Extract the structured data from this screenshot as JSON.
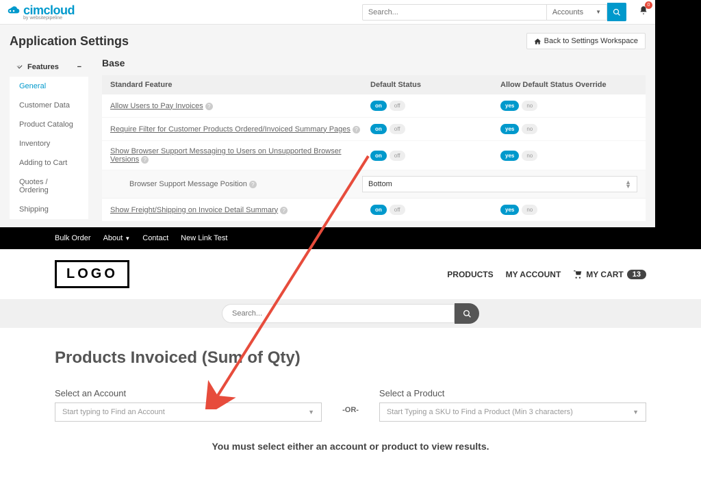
{
  "admin": {
    "search_placeholder": "Search...",
    "accounts_label": "Accounts",
    "bell_count": "0",
    "page_title": "Application Settings",
    "back_button": "Back to Settings Workspace",
    "sidebar": {
      "header": "Features",
      "items": [
        "General",
        "Customer Data",
        "Product Catalog",
        "Inventory",
        "Adding to Cart",
        "Quotes / Ordering",
        "Shipping"
      ]
    },
    "section_title": "Base",
    "columns": {
      "feature": "Standard Feature",
      "status": "Default Status",
      "override": "Allow Default Status Override"
    },
    "toggles": {
      "on": "on",
      "off": "off",
      "yes": "yes",
      "no": "no"
    },
    "features": [
      "Allow Users to Pay Invoices",
      "Require Filter for Customer Products Ordered/Invoiced Summary Pages",
      "Show Browser Support Messaging to Users on Unsupported Browser Versions",
      "Show Freight/Shipping on Invoice Detail Summary"
    ],
    "sub": {
      "label": "Browser Support Message Position",
      "value": "Bottom"
    }
  },
  "store": {
    "nav": {
      "bulk": "Bulk Order",
      "about": "About",
      "contact": "Contact",
      "newlink": "New Link Test"
    },
    "logo": "LOGO",
    "header": {
      "products": "PRODUCTS",
      "account": "MY ACCOUNT",
      "cart": "MY CART",
      "cart_count": "13"
    },
    "search_placeholder": "Search...",
    "page_title": "Products Invoiced (Sum of Qty)",
    "account_label": "Select an Account",
    "account_placeholder": "Start typing to Find an Account",
    "or": "-OR-",
    "product_label": "Select a Product",
    "product_placeholder": "Start Typing a SKU to Find a Product (Min 3 characters)",
    "must_select": "You must select either an account or product to view results."
  }
}
